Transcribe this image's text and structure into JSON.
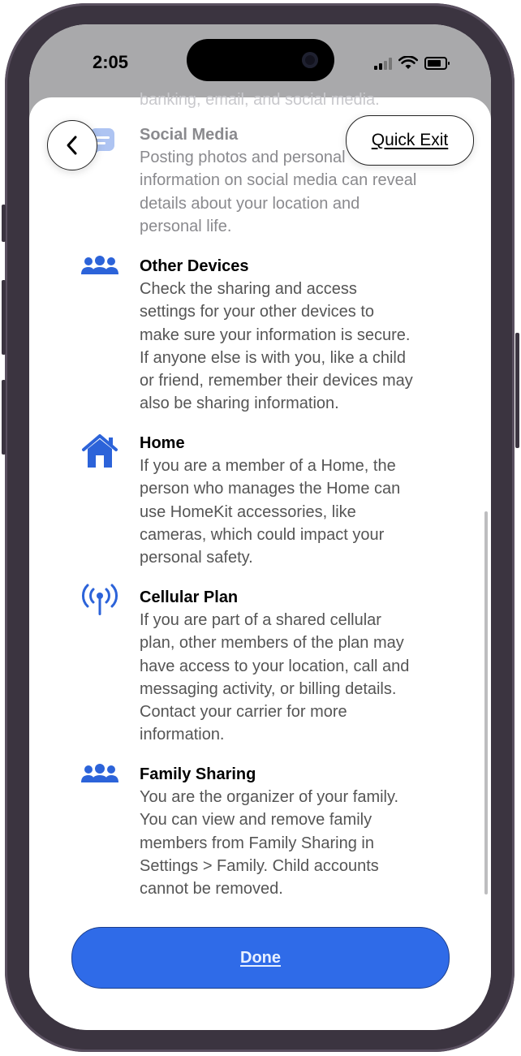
{
  "status_bar": {
    "time": "2:05"
  },
  "header": {
    "quick_exit_label": "Quick Exit"
  },
  "faded_line": "banking, email, and social media.",
  "items": [
    {
      "title": "Social Media",
      "icon": "message-bubble-icon",
      "desc_lines": [
        "Posting photos and personal",
        "information on social media can reveal",
        "details about your location and",
        "personal life."
      ]
    },
    {
      "title": "Other Devices",
      "icon": "people-group-icon",
      "desc_lines": [
        "Check the sharing and access",
        "settings for your other devices to",
        "make sure your information is secure.",
        "If anyone else is with you, like a child",
        "or friend, remember their devices may",
        "also be sharing information."
      ]
    },
    {
      "title": "Home",
      "icon": "house-icon",
      "desc_lines": [
        "If you are a member of a Home, the",
        "person who manages the Home can",
        "use HomeKit accessories, like",
        "cameras, which could impact your",
        "personal safety."
      ]
    },
    {
      "title": "Cellular Plan",
      "icon": "antenna-icon",
      "desc_lines": [
        "If you are part of a shared cellular",
        "plan, other members of the plan may",
        "have access to your location, call and",
        "messaging activity, or billing details.",
        "Contact your carrier for more",
        "information."
      ]
    },
    {
      "title": "Family Sharing",
      "icon": "people-group-icon",
      "desc_lines": [
        "You are the organizer of your family.",
        "You can view and remove family",
        "members from Family Sharing in",
        "Settings > Family. Child accounts",
        "cannot be removed."
      ]
    }
  ],
  "footer": {
    "done_label": "Done"
  },
  "colors": {
    "accent": "#2f6be8",
    "icon_blue": "#2c63d9"
  }
}
